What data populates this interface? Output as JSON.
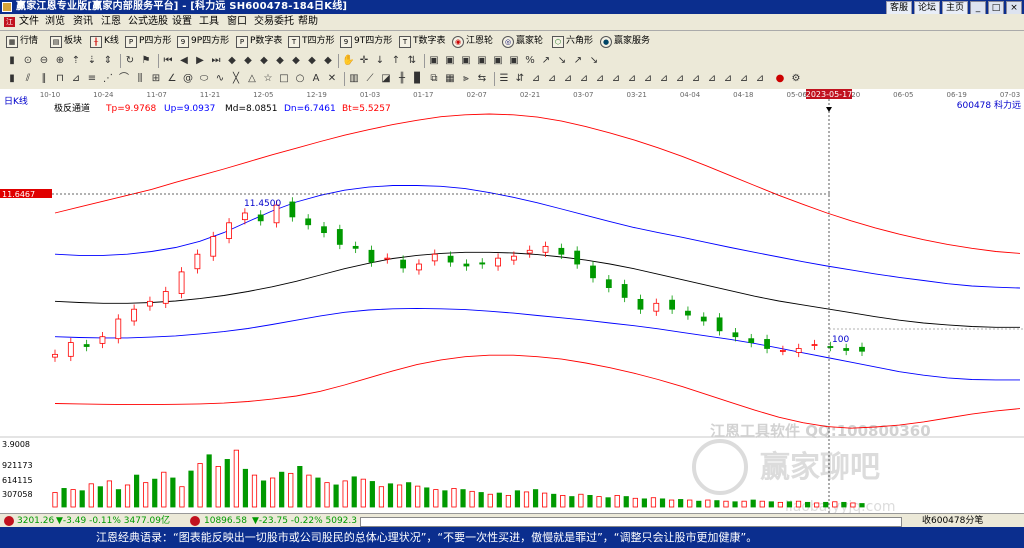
{
  "window": {
    "title": "赢家江恩专业版[赢家内部服务平台] - [科力远  SH600478-184日K线]",
    "tab_buttons": [
      "客服",
      "论坛",
      "主页"
    ],
    "controls": [
      "_",
      "□",
      "×"
    ]
  },
  "menu": {
    "logo": "江",
    "items": [
      "文件",
      "浏览",
      "资讯",
      "江恩",
      "公式选股",
      "设置",
      "工具",
      "窗口",
      "交易委托",
      "帮助"
    ]
  },
  "toolbar1": {
    "items": [
      "行情",
      "板块",
      "K线",
      "P四方形",
      "9P四方形",
      "P数字表",
      "T四方形",
      "9T四方形",
      "T数字表",
      "江恩轮",
      "赢家轮",
      "六角形",
      "赢家服务"
    ],
    "icons": [
      "grid-icon",
      "panel-icon",
      "candles-icon",
      "p-square-icon",
      "9p-square-icon",
      "p-table-icon",
      "t-square-icon",
      "9t-square-icon",
      "t-table-icon",
      "gann-wheel-icon",
      "winner-wheel-icon",
      "hexagon-icon",
      "service-icon"
    ]
  },
  "chart": {
    "period_label": "日K线",
    "indicator": {
      "name": "极反通道",
      "tp": "Tp=9.9768",
      "up": "Up=9.0937",
      "md": "Md=8.0851",
      "dn": "Dn=6.7461",
      "bt": "Bt=5.5257"
    },
    "stock_code_name": "600478  科力远",
    "dates": [
      "10-10",
      "10-24",
      "11-07",
      "11-21",
      "12-05",
      "12-19",
      "01-03",
      "01-17",
      "02-07",
      "02-21",
      "03-07",
      "03-21",
      "04-04",
      "04-18",
      "05-06",
      "05-20",
      "06-05",
      "06-19",
      "07-03"
    ],
    "cursor_date": "2023-05-17",
    "high_price_tag": "11.6467",
    "high_label": "11.4500",
    "low_label": "100",
    "volume_axis": [
      "3.9008",
      "921173",
      "614115",
      "307058"
    ],
    "watermark": {
      "line1": "江恩工具软件  QQ:100800360",
      "line2": "赢家聊吧",
      "line3": "liaoba.yyjq.com"
    },
    "chart_data": {
      "type": "candlestick",
      "price_range": [
        5.5,
        13.8
      ],
      "series": [
        {
          "name": "Tp",
          "values": [
            11.0,
            11.15,
            11.3,
            11.45,
            11.6,
            11.78,
            11.95,
            12.12,
            12.3,
            12.48,
            12.65,
            12.82,
            12.98,
            13.12,
            13.25,
            13.36,
            13.45,
            13.5,
            13.52,
            13.5,
            13.44,
            13.34,
            13.2,
            13.04,
            12.86,
            12.66,
            12.44,
            12.2,
            11.95,
            11.7,
            11.45,
            11.22,
            11.0,
            10.8,
            10.62,
            10.46,
            10.32,
            10.2,
            10.1,
            10.02,
            9.97
          ]
        },
        {
          "name": "Up",
          "values": [
            9.95,
            9.92,
            9.92,
            9.95,
            10.02,
            10.12,
            10.28,
            10.5,
            10.78,
            11.05,
            11.28,
            11.45,
            11.58,
            11.66,
            11.7,
            11.7,
            11.68,
            11.62,
            11.52,
            11.4,
            11.26,
            11.1,
            10.94,
            10.78,
            10.63,
            10.5,
            10.38,
            10.25,
            10.12,
            10.0,
            9.88,
            9.76,
            9.65,
            9.55,
            9.45,
            9.36,
            9.28,
            9.2,
            9.14,
            9.11,
            9.09
          ]
        },
        {
          "name": "Md",
          "values": [
            8.75,
            8.72,
            8.7,
            8.7,
            8.72,
            8.76,
            8.82,
            8.9,
            9.0,
            9.12,
            9.26,
            9.42,
            9.58,
            9.72,
            9.84,
            9.92,
            9.97,
            10.0,
            10.0,
            9.98,
            9.94,
            9.88,
            9.8,
            9.7,
            9.58,
            9.44,
            9.3,
            9.16,
            9.02,
            8.88,
            8.76,
            8.66,
            8.56,
            8.46,
            8.36,
            8.27,
            8.2,
            8.15,
            8.11,
            8.09,
            8.09
          ]
        },
        {
          "name": "Dn",
          "values": [
            7.85,
            7.83,
            7.82,
            7.82,
            7.84,
            7.87,
            7.92,
            7.98,
            8.06,
            8.16,
            8.27,
            8.38,
            8.47,
            8.53,
            8.56,
            8.57,
            8.56,
            8.54,
            8.5,
            8.45,
            8.39,
            8.33,
            8.27,
            8.2,
            8.13,
            8.05,
            7.96,
            7.87,
            7.78,
            7.68,
            7.56,
            7.44,
            7.32,
            7.2,
            7.08,
            6.96,
            6.87,
            6.8,
            6.76,
            6.75,
            6.75
          ]
        },
        {
          "name": "Bt",
          "values": [
            6.15,
            6.14,
            6.13,
            6.12,
            6.12,
            6.13,
            6.14,
            6.16,
            6.2,
            6.26,
            6.34,
            6.46,
            6.62,
            6.8,
            6.98,
            7.14,
            7.26,
            7.34,
            7.38,
            7.38,
            7.34,
            7.28,
            7.18,
            7.06,
            6.92,
            6.76,
            6.58,
            6.38,
            6.18,
            5.98,
            5.8,
            5.66,
            5.56,
            5.52,
            5.55,
            5.6,
            5.68,
            5.78,
            5.88,
            5.96,
            6.02
          ]
        }
      ],
      "closes": [
        7.4,
        7.7,
        7.6,
        7.85,
        8.3,
        8.55,
        8.75,
        9.0,
        9.5,
        9.95,
        10.4,
        10.75,
        11.0,
        10.8,
        11.2,
        10.9,
        10.7,
        10.5,
        10.2,
        10.1,
        9.75,
        9.85,
        9.6,
        9.7,
        9.95,
        9.75,
        9.65,
        9.7,
        9.85,
        9.9,
        10.05,
        10.15,
        9.95,
        9.7,
        9.35,
        9.1,
        8.85,
        8.55,
        8.7,
        8.55,
        8.4,
        8.25,
        8.0,
        7.85,
        7.7,
        7.55,
        7.5,
        7.55,
        7.65,
        7.6,
        7.5,
        7.48
      ]
    },
    "volumes": [
      0.25,
      0.32,
      0.3,
      0.28,
      0.4,
      0.35,
      0.45,
      0.3,
      0.38,
      0.55,
      0.42,
      0.48,
      0.6,
      0.5,
      0.35,
      0.62,
      0.75,
      0.9,
      0.7,
      0.82,
      0.98,
      0.65,
      0.55,
      0.45,
      0.5,
      0.6,
      0.58,
      0.7,
      0.55,
      0.5,
      0.42,
      0.38,
      0.45,
      0.52,
      0.48,
      0.44,
      0.35,
      0.4,
      0.38,
      0.42,
      0.36,
      0.33,
      0.3,
      0.28,
      0.32,
      0.3,
      0.27,
      0.25,
      0.22,
      0.24,
      0.2,
      0.28,
      0.26,
      0.3,
      0.24,
      0.22,
      0.2,
      0.18,
      0.22,
      0.2,
      0.18,
      0.16,
      0.2,
      0.18,
      0.15,
      0.14,
      0.16,
      0.14,
      0.12,
      0.13,
      0.12,
      0.1,
      0.12,
      0.11,
      0.1,
      0.09,
      0.1,
      0.12,
      0.1,
      0.09,
      0.08,
      0.09,
      0.1,
      0.08,
      0.07,
      0.08,
      0.09,
      0.08,
      0.07,
      0.06
    ],
    "colors": {
      "up": "#ff0000",
      "down": "#009900",
      "tp": "#ff0000",
      "up_line": "#0000ff",
      "md": "#000000",
      "dn": "#0000ff",
      "bt": "#ff0000"
    }
  },
  "status": {
    "sh_index": "3201.26",
    "sh_change": "▼-3.49 -0.11% 3477.09亿",
    "sz_index": "10896.58",
    "sz_change": "▼-23.75 -0.22% 5092.3",
    "right_text": "收600478分笔"
  },
  "quote": "江恩经典语录：“图表能反映出一切股市或公司股民的总体心理状况”，“不要一次性买进，傲慢就是罪过”，“调整只会让股市更加健康”。"
}
